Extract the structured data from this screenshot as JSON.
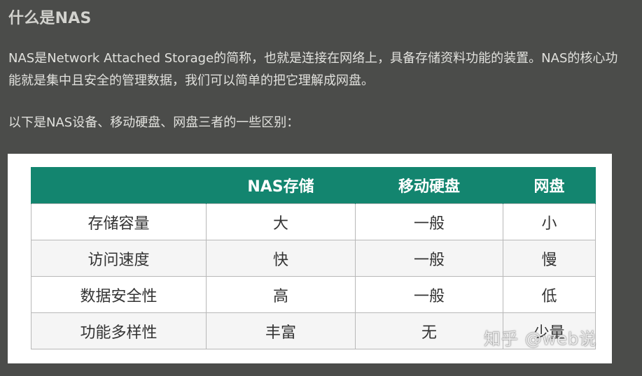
{
  "article": {
    "heading": "什么是NAS",
    "paragraph_1": "NAS是Network Attached Storage的简称，也就是连接在网络上，具备存储资料功能的装置。NAS的核心功能就是集中且安全的管理数据，我们可以简单的把它理解成网盘。",
    "paragraph_2": "以下是NAS设备、移动硬盘、网盘三者的一些区别："
  },
  "comparison_table": {
    "headers": [
      "",
      "NAS存储",
      "移动硬盘",
      "网盘"
    ],
    "rows": [
      [
        "存储容量",
        "大",
        "一般",
        "小"
      ],
      [
        "访问速度",
        "快",
        "一般",
        "慢"
      ],
      [
        "数据安全性",
        "高",
        "一般",
        "低"
      ],
      [
        "功能多样性",
        "丰富",
        "无",
        "少量"
      ]
    ],
    "header_color": "#13856f"
  },
  "watermark": "知乎 @web说"
}
